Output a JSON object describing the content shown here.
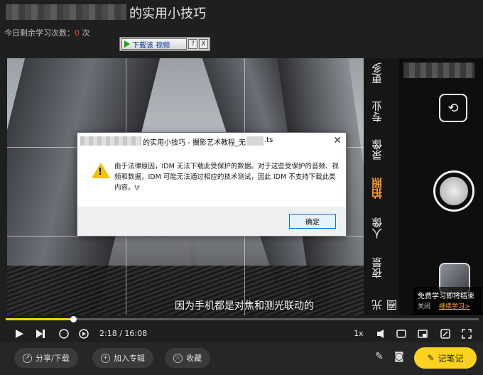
{
  "header": {
    "title_suffix": "的实用小技巧",
    "quota_label": "今日剩余学习次数：",
    "quota_value": "0",
    "quota_unit": "次"
  },
  "idm": {
    "download_label": "下载该 视频",
    "help_label": "?",
    "close_label": "X"
  },
  "dialog": {
    "title_part1": "的实用小技巧 - 摄影艺术教程_无",
    "title_ext": ".ts",
    "close_label": "✕",
    "message": "由于法律原因，IDM 无法下载此受保护的数据。对于这些受保护的音频、视频和数据，IDM 可能无法通过相应的技术测试，因此 IDM 不支持下载此类内容。\\r",
    "ok_label": "确定"
  },
  "phone": {
    "modes": [
      "更多",
      "专业",
      "录像",
      "拍照",
      "人像",
      "夜景",
      "光圈"
    ],
    "active_mode": "拍照",
    "promo_line1": "免费学习即将结束",
    "promo_close": "关闭",
    "promo_link": "继续学习>"
  },
  "player": {
    "subtitle": "因为手机都是对焦和测光联动的",
    "time": "2:18 / 16:08",
    "speed": "1x",
    "progress": 0.143
  },
  "bottom": {
    "share_label": "分享/下载",
    "album_label": "加入专辑",
    "fav_label": "收藏",
    "note_label": "记笔记"
  },
  "colors": {
    "accent": "#ffd21f",
    "quota_red": "#ff3b3b",
    "active_mode": "#ff9b25"
  }
}
